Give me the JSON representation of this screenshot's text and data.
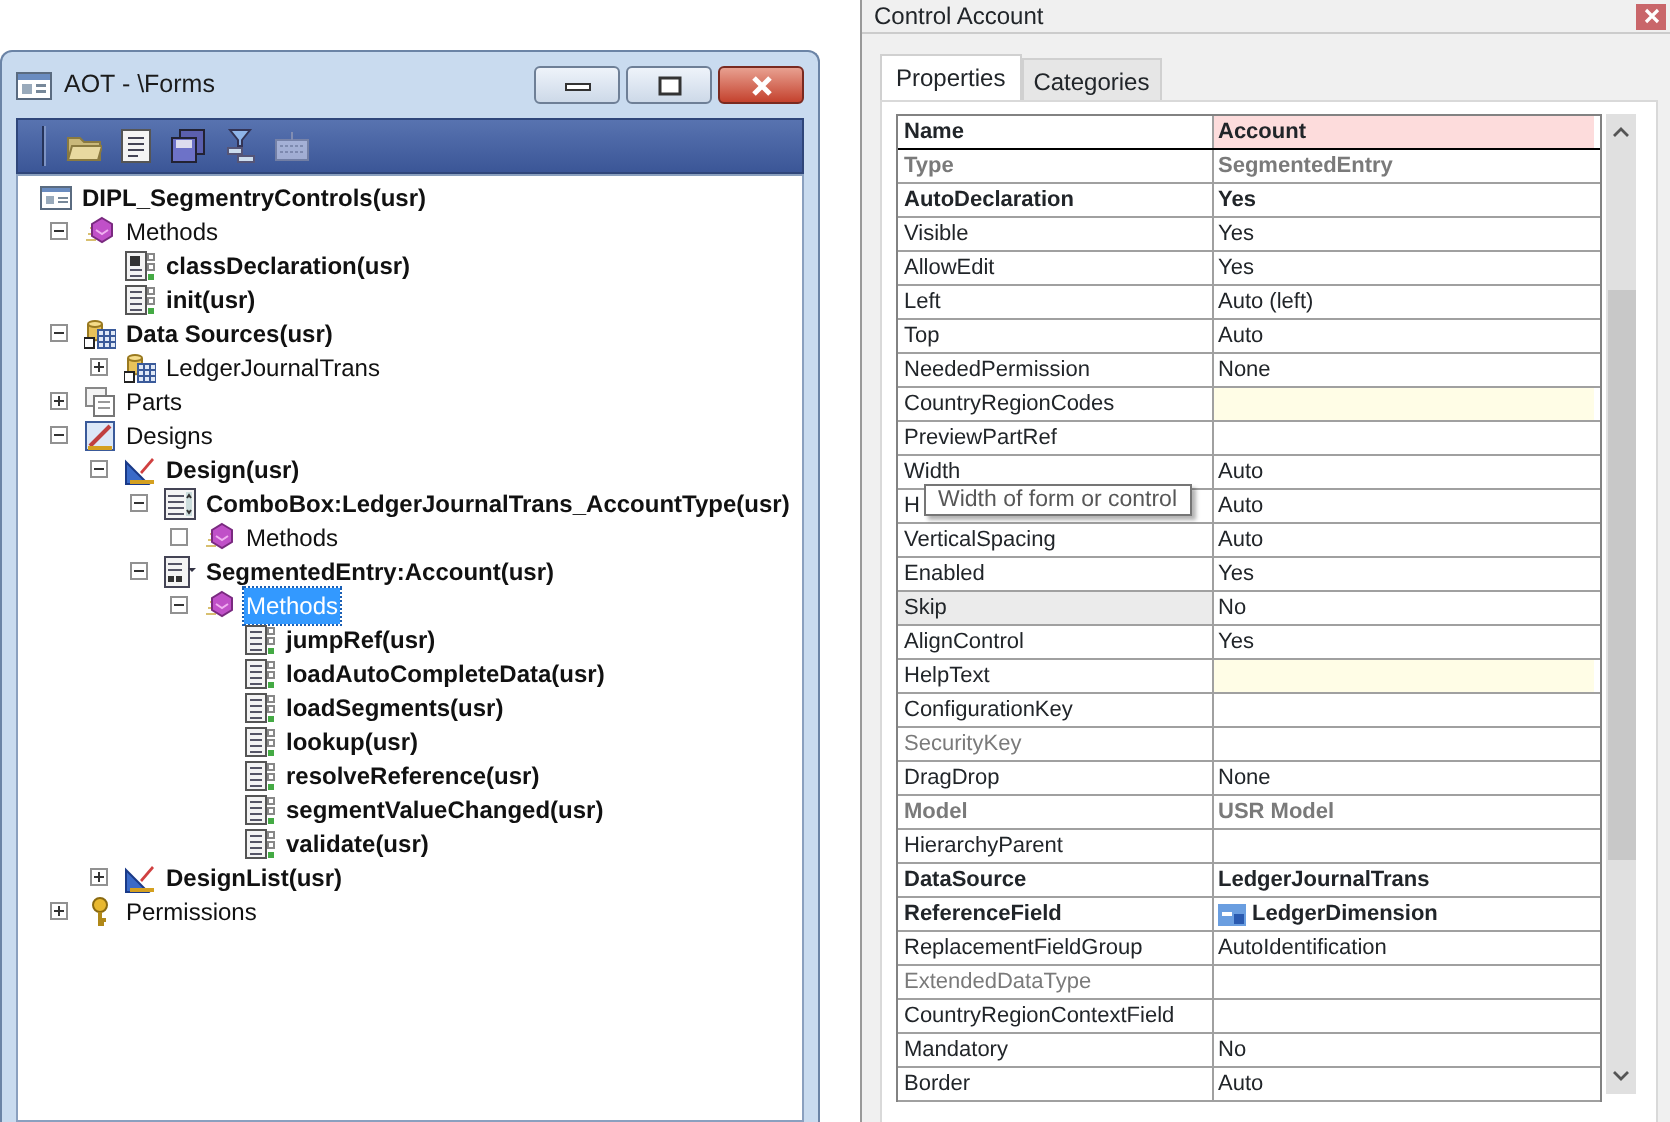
{
  "aot_window": {
    "title": "AOT - \\Forms",
    "toolbar": [
      {
        "kind": "open",
        "disabled": false
      },
      {
        "kind": "properties",
        "disabled": false
      },
      {
        "kind": "save",
        "disabled": false
      },
      {
        "kind": "filter",
        "disabled": false
      },
      {
        "kind": "keyboard",
        "disabled": true
      }
    ],
    "tree": [
      {
        "label": "DIPL_SegmentryControls(usr)",
        "kind": "form",
        "bold": true,
        "selected": false,
        "children": [
          {
            "label": "Methods",
            "kind": "methods",
            "bold": false,
            "selected": false,
            "expanded": true,
            "children": [
              {
                "label": "classDeclaration(usr)",
                "kind": "classdecl",
                "bold": true,
                "selected": false
              },
              {
                "label": "init(usr)",
                "kind": "method",
                "bold": true,
                "selected": false
              }
            ]
          },
          {
            "label": "Data Sources(usr)",
            "kind": "datasource",
            "bold": true,
            "selected": false,
            "expanded": true,
            "children": [
              {
                "label": "LedgerJournalTrans",
                "kind": "datasource",
                "bold": false,
                "selected": false,
                "expanded": false
              }
            ]
          },
          {
            "label": "Parts",
            "kind": "parts",
            "bold": false,
            "selected": false,
            "expanded": false
          },
          {
            "label": "Designs",
            "kind": "designs",
            "bold": false,
            "selected": false,
            "expanded": true,
            "children": [
              {
                "label": "Design(usr)",
                "kind": "design",
                "bold": true,
                "selected": false,
                "expanded": true,
                "children": [
                  {
                    "label": "ComboBox:LedgerJournalTrans_AccountType(usr)",
                    "kind": "combobox",
                    "bold": true,
                    "selected": false,
                    "expanded": true,
                    "children": [
                      {
                        "label": "Methods",
                        "kind": "methods",
                        "bold": false,
                        "selected": false,
                        "expanded": true
                      }
                    ]
                  },
                  {
                    "label": "SegmentedEntry:Account(usr)",
                    "kind": "segmented",
                    "bold": true,
                    "selected": false,
                    "expanded": true,
                    "children": [
                      {
                        "label": "Methods",
                        "kind": "methods",
                        "bold": false,
                        "selected": true,
                        "expanded": true,
                        "children": [
                          {
                            "label": "jumpRef(usr)",
                            "kind": "method",
                            "bold": true,
                            "selected": false
                          },
                          {
                            "label": "loadAutoCompleteData(usr)",
                            "kind": "method",
                            "bold": true,
                            "selected": false
                          },
                          {
                            "label": "loadSegments(usr)",
                            "kind": "method",
                            "bold": true,
                            "selected": false
                          },
                          {
                            "label": "lookup(usr)",
                            "kind": "method",
                            "bold": true,
                            "selected": false
                          },
                          {
                            "label": "resolveReference(usr)",
                            "kind": "method",
                            "bold": true,
                            "selected": false
                          },
                          {
                            "label": "segmentValueChanged(usr)",
                            "kind": "method",
                            "bold": true,
                            "selected": false
                          },
                          {
                            "label": "validate(usr)",
                            "kind": "method",
                            "bold": true,
                            "selected": false
                          }
                        ]
                      }
                    ]
                  }
                ]
              },
              {
                "label": "DesignList(usr)",
                "kind": "design",
                "bold": true,
                "selected": false,
                "expanded": false
              }
            ]
          },
          {
            "label": "Permissions",
            "kind": "permissions",
            "bold": false,
            "selected": false,
            "expanded": false
          }
        ]
      }
    ]
  },
  "properties_window": {
    "title": "Control Account",
    "tabs": [
      {
        "label": "Properties",
        "selected": true
      },
      {
        "label": "Categories",
        "selected": false
      }
    ],
    "rows": [
      {
        "name": "Name",
        "value": "Account",
        "bold": true,
        "disabled": false,
        "selected": false,
        "color": "#fddcdc"
      },
      {
        "name": "Type",
        "value": "SegmentedEntry",
        "bold": true,
        "disabled": true,
        "selected": false
      },
      {
        "name": "AutoDeclaration",
        "value": "Yes",
        "bold": true,
        "disabled": false,
        "selected": false
      },
      {
        "name": "Visible",
        "value": "Yes",
        "bold": false,
        "disabled": false,
        "selected": false
      },
      {
        "name": "AllowEdit",
        "value": "Yes",
        "bold": false,
        "disabled": false,
        "selected": false
      },
      {
        "name": "Left",
        "value": "Auto (left)",
        "bold": false,
        "disabled": false,
        "selected": false
      },
      {
        "name": "Top",
        "value": "Auto",
        "bold": false,
        "disabled": false,
        "selected": false
      },
      {
        "name": "NeededPermission",
        "value": "None",
        "bold": false,
        "disabled": false,
        "selected": false
      },
      {
        "name": "CountryRegionCodes",
        "bold": false,
        "disabled": false,
        "selected": false,
        "color": "#fffde6"
      },
      {
        "name": "PreviewPartRef",
        "bold": false,
        "disabled": false,
        "selected": false
      },
      {
        "name": "Width",
        "value": "Auto",
        "bold": false,
        "disabled": false,
        "selected": false
      },
      {
        "name": "H",
        "value": "Auto",
        "bold": false,
        "disabled": false,
        "selected": false
      },
      {
        "name": "VerticalSpacing",
        "value": "Auto",
        "bold": false,
        "disabled": false,
        "selected": false
      },
      {
        "name": "Enabled",
        "value": "Yes",
        "bold": false,
        "disabled": false,
        "selected": false
      },
      {
        "name": "Skip",
        "value": "No",
        "bold": false,
        "disabled": false,
        "selected": true
      },
      {
        "name": "AlignControl",
        "value": "Yes",
        "bold": false,
        "disabled": false,
        "selected": false
      },
      {
        "name": "HelpText",
        "bold": false,
        "disabled": false,
        "selected": false,
        "color": "#fffde6"
      },
      {
        "name": "ConfigurationKey",
        "bold": false,
        "disabled": false,
        "selected": false
      },
      {
        "name": "SecurityKey",
        "bold": false,
        "disabled": true,
        "selected": false
      },
      {
        "name": "DragDrop",
        "value": "None",
        "bold": false,
        "disabled": false,
        "selected": false
      },
      {
        "name": "Model",
        "value": "USR Model",
        "bold": true,
        "disabled": true,
        "selected": false
      },
      {
        "name": "HierarchyParent",
        "bold": false,
        "disabled": false,
        "selected": false
      },
      {
        "name": "DataSource",
        "value": "LedgerJournalTrans",
        "bold": true,
        "disabled": false,
        "selected": false
      },
      {
        "name": "ReferenceField",
        "value": "LedgerDimension",
        "bold": true,
        "disabled": false,
        "selected": false,
        "kind": "field"
      },
      {
        "name": "ReplacementFieldGroup",
        "value": "AutoIdentification",
        "bold": false,
        "disabled": false,
        "selected": false
      },
      {
        "name": "ExtendedDataType",
        "bold": false,
        "disabled": true,
        "selected": false
      },
      {
        "name": "CountryRegionContextField",
        "bold": false,
        "disabled": false,
        "selected": false
      },
      {
        "name": "Mandatory",
        "value": "No",
        "bold": false,
        "disabled": false,
        "selected": false
      },
      {
        "name": "Border",
        "value": "Auto",
        "bold": false,
        "disabled": false,
        "selected": false
      }
    ],
    "tooltip": {
      "text": "Width of form or control"
    }
  }
}
